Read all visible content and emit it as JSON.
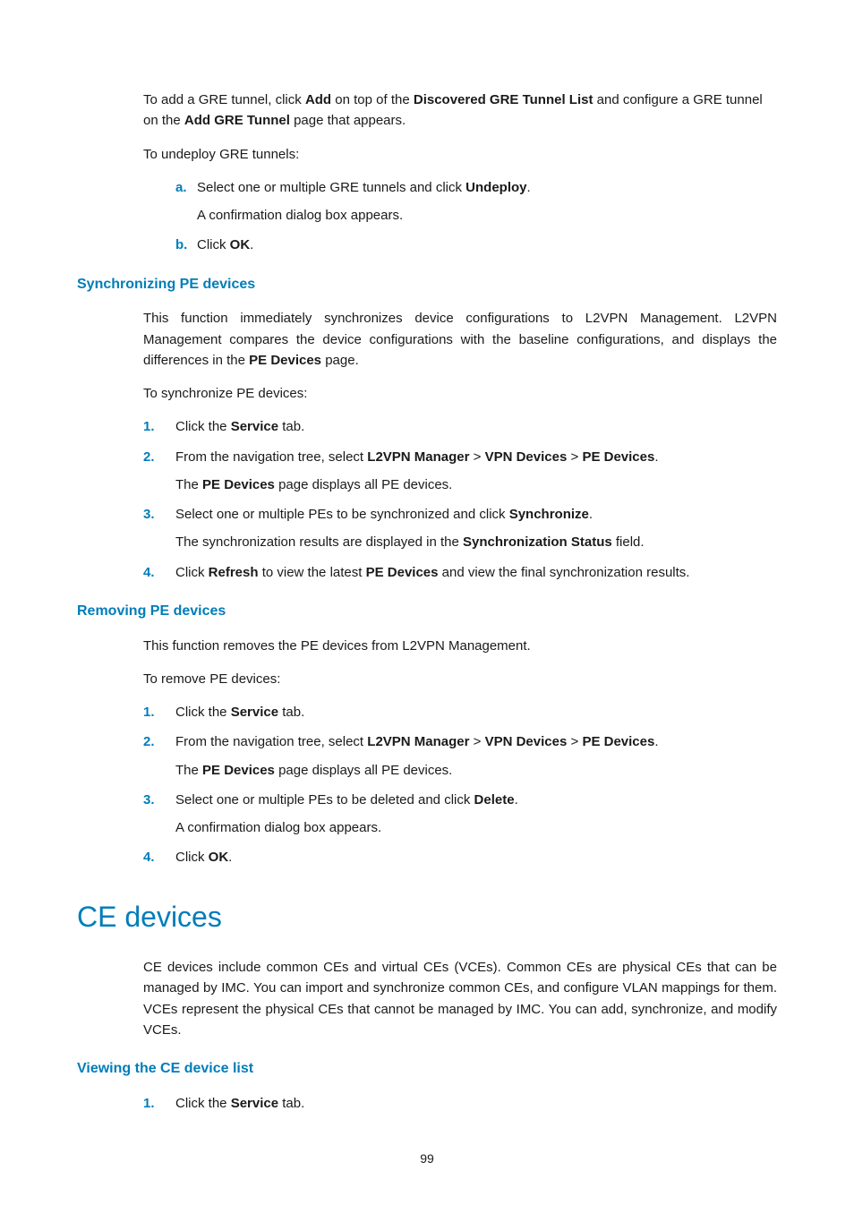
{
  "intro1": {
    "pre": "To add a GRE tunnel, click ",
    "b1": "Add",
    "mid1": " on top of the ",
    "b2": "Discovered GRE Tunnel List",
    "mid2": " and configure a GRE tunnel on the ",
    "b3": "Add GRE Tunnel",
    "post": " page that appears."
  },
  "undeployLead": "To undeploy GRE tunnels:",
  "undeploy_a": {
    "pre": "Select one or multiple GRE tunnels and click ",
    "b": "Undeploy",
    "post": "."
  },
  "undeploy_a2": "A confirmation dialog box appears.",
  "undeploy_b": {
    "pre": "Click ",
    "b": "OK",
    "post": "."
  },
  "syncHeading": "Synchronizing PE devices",
  "syncPara": {
    "pre": "This function immediately synchronizes device configurations to L2VPN Management. L2VPN Management compares the device configurations with the baseline configurations, and displays the differences in the ",
    "b": "PE Devices",
    "post": " page."
  },
  "syncLead": "To synchronize PE devices:",
  "sync1": {
    "pre": "Click the ",
    "b": "Service",
    "post": " tab."
  },
  "sync2": {
    "pre": "From the navigation tree, select ",
    "b1": "L2VPN Manager",
    "gt": " > ",
    "b2": "VPN Devices",
    "b3": "PE Devices",
    "post": "."
  },
  "sync2b": {
    "pre": "The ",
    "b": "PE Devices",
    "post": " page displays all PE devices."
  },
  "sync3": {
    "pre": "Select one or multiple PEs to be synchronized and click ",
    "b": "Synchronize",
    "post": "."
  },
  "sync3b": {
    "pre": "The synchronization results are displayed in the ",
    "b": "Synchronization Status",
    "post": " field."
  },
  "sync4": {
    "pre": "Click ",
    "b1": "Refresh",
    "mid": " to view the latest ",
    "b2": "PE Devices",
    "post": " and view the final synchronization results."
  },
  "removeHeading": "Removing PE devices",
  "removePara": "This function removes the PE devices from L2VPN Management.",
  "removeLead": "To remove PE devices:",
  "rem1": {
    "pre": "Click the ",
    "b": "Service",
    "post": " tab."
  },
  "rem2": {
    "pre": "From the navigation tree, select ",
    "b1": "L2VPN Manager",
    "gt": " > ",
    "b2": "VPN Devices",
    "b3": "PE Devices",
    "post": "."
  },
  "rem2b": {
    "pre": "The ",
    "b": "PE Devices",
    "post": " page displays all PE devices."
  },
  "rem3": {
    "pre": "Select one or multiple PEs to be deleted and click ",
    "b": "Delete",
    "post": "."
  },
  "rem3b": "A confirmation dialog box appears.",
  "rem4": {
    "pre": "Click ",
    "b": "OK",
    "post": "."
  },
  "ceHeading": "CE devices",
  "cePara": "CE devices include common CEs and virtual CEs (VCEs). Common CEs are physical CEs that can be managed by IMC. You can import and synchronize common CEs, and configure VLAN mappings for them. VCEs represent the physical CEs that cannot be managed by IMC. You can add, synchronize, and modify VCEs.",
  "viewHeading": "Viewing the CE device list",
  "view1": {
    "pre": "Click the ",
    "b": "Service",
    "post": " tab."
  },
  "markers": {
    "a": "a.",
    "b": "b.",
    "n1": "1.",
    "n2": "2.",
    "n3": "3.",
    "n4": "4."
  },
  "pageNum": "99"
}
